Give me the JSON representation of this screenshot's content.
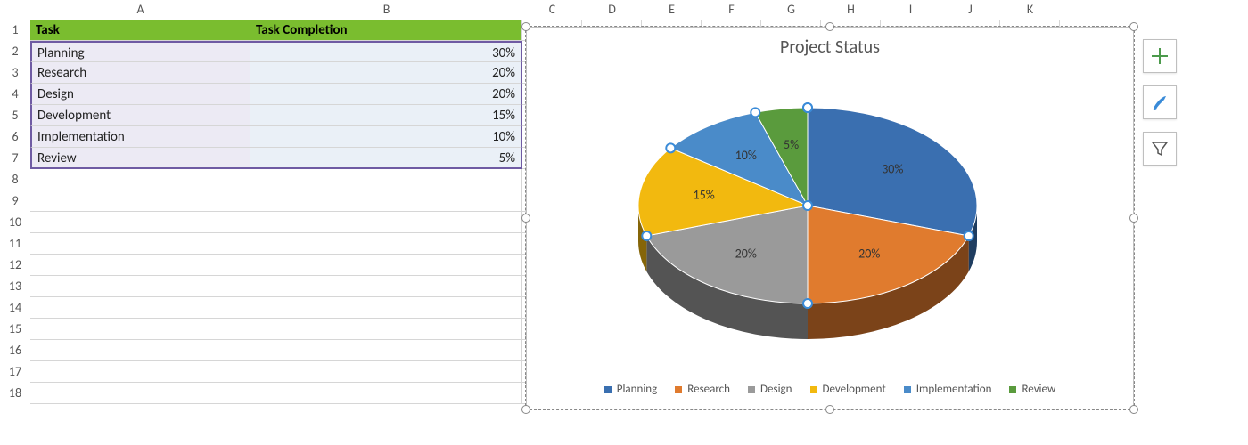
{
  "columns": [
    "A",
    "B",
    "C",
    "D",
    "E",
    "F",
    "G",
    "H",
    "I",
    "J",
    "K"
  ],
  "col_widths": {
    "A": 247,
    "B": 305,
    "other": 67
  },
  "row_count": 18,
  "table": {
    "headers": {
      "task": "Task",
      "completion": "Task Completion"
    },
    "rows": [
      {
        "task": "Planning",
        "completion": "30%"
      },
      {
        "task": "Research",
        "completion": "20%"
      },
      {
        "task": "Design",
        "completion": "20%"
      },
      {
        "task": "Development",
        "completion": "15%"
      },
      {
        "task": "Implementation",
        "completion": "10%"
      },
      {
        "task": "Review",
        "completion": "5%"
      }
    ]
  },
  "chart": {
    "title": "Project Status",
    "legend": [
      "Planning",
      "Research",
      "Design",
      "Development",
      "Implementation",
      "Review"
    ],
    "colors": [
      "#3a6fb0",
      "#e07b2e",
      "#9a9a9a",
      "#f2b90f",
      "#4a8bc9",
      "#5a9b3d"
    ],
    "labels": [
      "30%",
      "20%",
      "20%",
      "15%",
      "10%",
      "5%"
    ]
  },
  "chart_data": {
    "type": "pie",
    "title": "Project Status",
    "categories": [
      "Planning",
      "Research",
      "Design",
      "Development",
      "Implementation",
      "Review"
    ],
    "values": [
      30,
      20,
      20,
      15,
      10,
      5
    ],
    "unit": "%",
    "legend_position": "bottom",
    "style": "3d"
  }
}
